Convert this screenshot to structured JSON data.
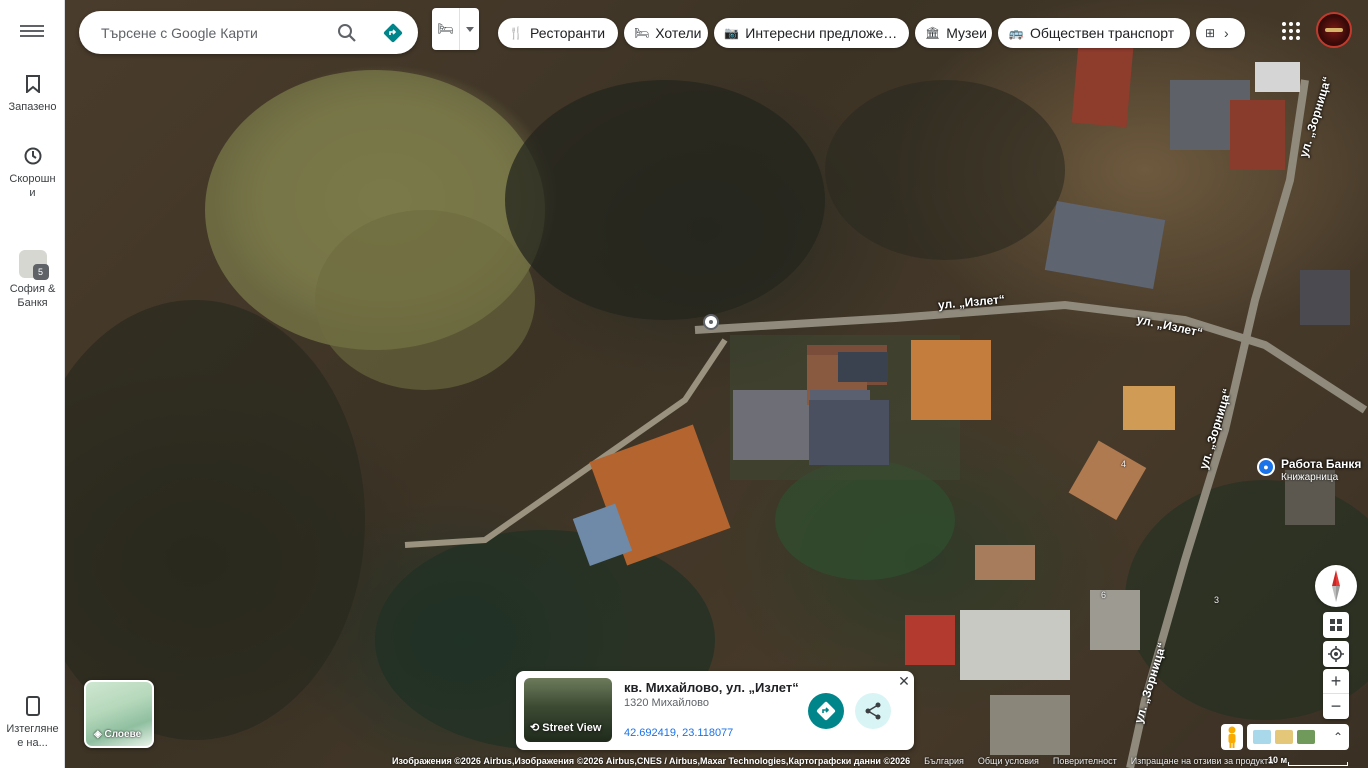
{
  "sidebar": {
    "saved_label": "Запазено",
    "recent_label_line1": "Скорошн",
    "recent_label_line2": "и",
    "recent_place_line1": "София &",
    "recent_place_line2": "Банкя",
    "recent_badge": "5",
    "app_label_line1": "Изтегляне",
    "app_label_line2": "е на..."
  },
  "search": {
    "placeholder": "Търсене с Google Карти"
  },
  "chips": [
    {
      "label": "Ресторанти",
      "icon": "fork-knife-icon"
    },
    {
      "label": "Хотели",
      "icon": "bed-icon"
    },
    {
      "label": "Интересни предложения",
      "icon": "camera-icon"
    },
    {
      "label": "Музеи",
      "icon": "museum-icon"
    },
    {
      "label": "Обществен транспорт",
      "icon": "bus-icon"
    }
  ],
  "map": {
    "streets": [
      {
        "name": "ул. „Излет“"
      },
      {
        "name": "ул. „Излет“"
      },
      {
        "name": "ул. „Зорница“"
      },
      {
        "name": "ул. „Зорница“"
      },
      {
        "name": "ул. „Зорница“"
      }
    ],
    "house_numbers": [
      "4",
      "6",
      "3"
    ],
    "poi": {
      "name": "Работа Банкя",
      "category": "Книжарница"
    }
  },
  "layers": {
    "label": "Слоеве"
  },
  "info_card": {
    "street_view_label": "Street View",
    "title": "кв. Михайлово, ул. „Излет“",
    "subtitle": "1320 Михайлово",
    "coordinates": "42.692419, 23.118077",
    "close_label": "✕"
  },
  "footer": {
    "attribution": "Изображения ©2026 Airbus,Изображения ©2026 Airbus,CNES / Airbus,Maxar Technologies,Картографски данни ©2026",
    "country": "България",
    "terms": "Общи условия",
    "privacy": "Поверителност",
    "feedback": "Изпращане на отзиви за продукта",
    "scale": "10 м"
  },
  "colors": {
    "accent": "#00858a",
    "link": "#1a73e8",
    "poi_blue": "#1a73e8"
  }
}
